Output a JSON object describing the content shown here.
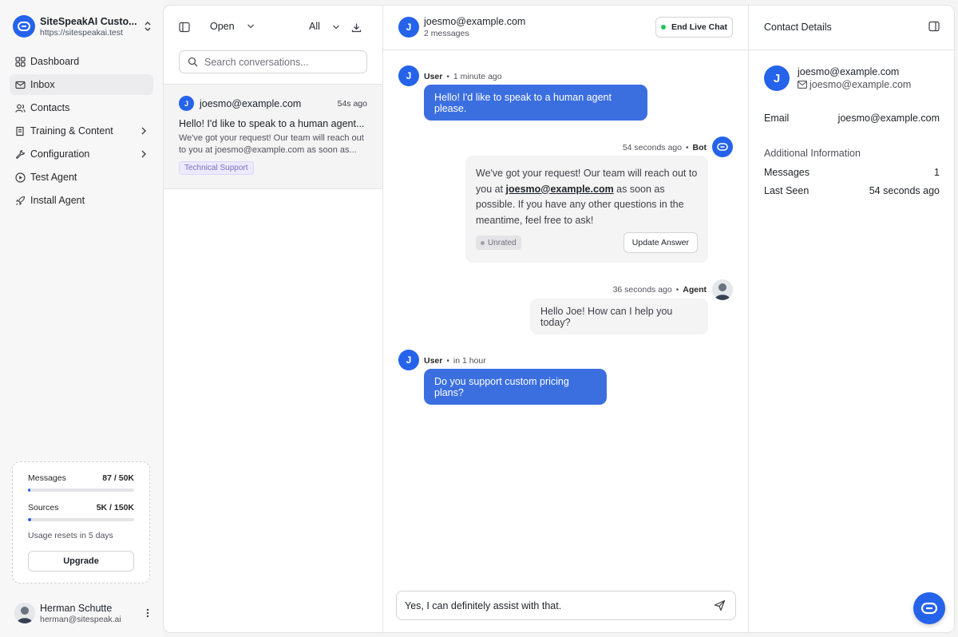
{
  "workspace": {
    "name": "SiteSpeakAI Custo...",
    "url": "https://sitespeakai.test"
  },
  "nav": {
    "items": [
      {
        "label": "Dashboard",
        "icon": "dashboard-icon"
      },
      {
        "label": "Inbox",
        "icon": "inbox-icon",
        "active": true
      },
      {
        "label": "Contacts",
        "icon": "contacts-icon"
      },
      {
        "label": "Training & Content",
        "icon": "training-icon",
        "has_children": true
      },
      {
        "label": "Configuration",
        "icon": "wrench-icon",
        "has_children": true
      },
      {
        "label": "Test Agent",
        "icon": "play-icon"
      },
      {
        "label": "Install Agent",
        "icon": "rocket-icon"
      }
    ]
  },
  "usage": {
    "messages_label": "Messages",
    "messages_value": "87 / 50K",
    "messages_fraction": 0.002,
    "sources_label": "Sources",
    "sources_value": "5K / 150K",
    "sources_fraction": 0.033,
    "reset_note": "Usage resets in 5 days",
    "upgrade_label": "Upgrade"
  },
  "user": {
    "name": "Herman Schutte",
    "email": "herman@sitespeak.ai"
  },
  "list": {
    "status_filter": "Open",
    "scope_filter": "All",
    "search_placeholder": "Search conversations...",
    "conversations": [
      {
        "initial": "J",
        "email": "joesmo@example.com",
        "time": "54s ago",
        "title": "Hello! I'd like to speak to a human agent...",
        "preview": "We've got your request! Our team will reach out to you at joesmo@example.com as soon as...",
        "tag": "Technical Support"
      }
    ]
  },
  "chat": {
    "initial": "J",
    "title": "joesmo@example.com",
    "subtitle": "2 messages",
    "end_chat_label": "End Live Chat",
    "messages": [
      {
        "role": "User",
        "time": "1 minute ago",
        "text": "Hello! I'd like to speak to a human agent please."
      },
      {
        "role": "Bot",
        "time": "54 seconds ago",
        "text_before": "We've got your request! Our team will reach out to you at ",
        "text_email": "joesmo@example.com",
        "text_after": " as soon as possible. If you have any other questions in the meantime, feel free to ask!",
        "rating": "Unrated",
        "action": "Update Answer"
      },
      {
        "role": "Agent",
        "time": "36 seconds ago",
        "text": "Hello Joe! How can I help you today?"
      },
      {
        "role": "User",
        "time": "in 1 hour",
        "text": "Do you support custom pricing plans?"
      }
    ],
    "composer_value": "Yes, I can definitely assist with that.",
    "separator": "•"
  },
  "details": {
    "header": "Contact Details",
    "initial": "J",
    "name": "joesmo@example.com",
    "email": "joesmo@example.com",
    "email_label": "Email",
    "email_value": "joesmo@example.com",
    "additional_header": "Additional Information",
    "messages_label": "Messages",
    "messages_value": "1",
    "last_seen_label": "Last Seen",
    "last_seen_value": "54 seconds ago"
  },
  "colors": {
    "accent": "#2563eb",
    "user_bubble": "#3b6fe0",
    "online": "#22c55e"
  }
}
